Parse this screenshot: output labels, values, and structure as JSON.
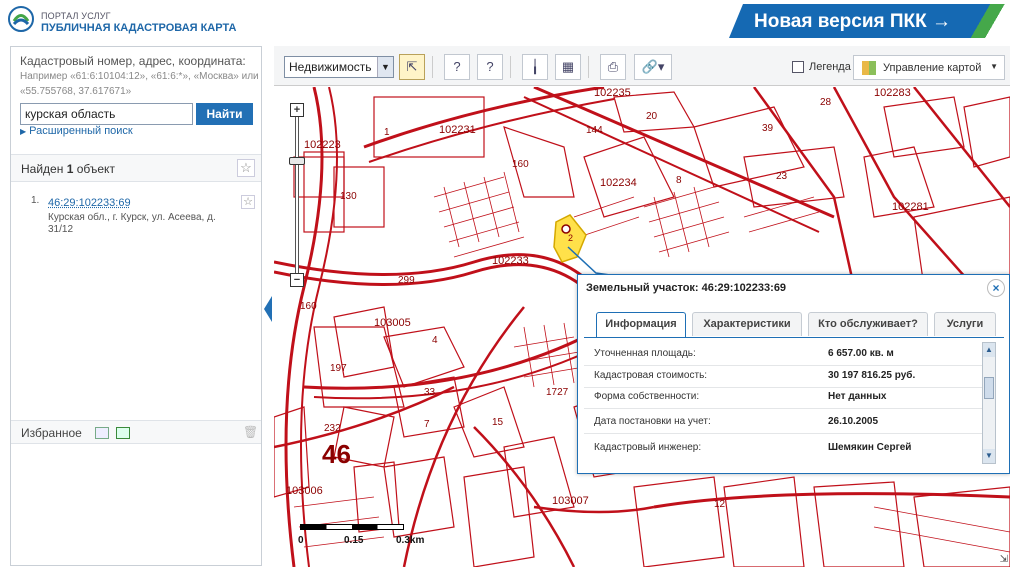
{
  "header": {
    "portal_line": "ПОРТАЛ УСЛУГ",
    "title": "ПУБЛИЧНАЯ КАДАСТРОВАЯ КАРТА",
    "new_version": "Новая версия ПКК →",
    "brand_color": "#1569b3"
  },
  "search": {
    "title": "Кадастровый номер, адрес, координата:",
    "example": "Например «61:6:10104:12», «61:6:*», «Москва» или «55.755768, 37.617671»",
    "value": "курская область",
    "button": "Найти",
    "advanced": "Расширенный поиск"
  },
  "results": {
    "found_prefix": "Найден",
    "found_count": "1",
    "found_suffix": "объект",
    "items": [
      {
        "num": "1.",
        "id": "46:29:102233:69",
        "address": "Курская обл., г. Курск, ул. Асеева, д. 31/12"
      }
    ]
  },
  "favorites": {
    "label": "Избранное"
  },
  "toolbar": {
    "layer": "Недвижимость",
    "legend": "Легенда",
    "map_control": "Управление картой"
  },
  "map": {
    "labels": [
      "102231",
      "102223",
      "102235",
      "160",
      "144",
      "20",
      "102234",
      "8",
      "23",
      "102281",
      "130",
      "1",
      "102233",
      "299",
      "103005",
      "160",
      "197",
      "4",
      "33",
      "7",
      "1727",
      "15",
      "103007",
      "12",
      "46",
      "103006",
      "232",
      "102283",
      "28",
      "39",
      "2"
    ],
    "scale": {
      "l0": "0",
      "l1": "0.15",
      "l2": "0.3km"
    }
  },
  "popup": {
    "title": "Земельный участок: 46:29:102233:69",
    "tabs": [
      "Информация",
      "Характеристики",
      "Кто обслуживает?",
      "Услуги"
    ],
    "rows": [
      {
        "label": "Уточненная площадь:",
        "value": "6 657.00 кв. м"
      },
      {
        "label": "Кадастровая стоимость:",
        "value": "30 197 816.25 руб."
      },
      {
        "label": "Форма собственности:",
        "value": "Нет данных"
      },
      {
        "label": "Дата постановки на учет:",
        "value": "26.10.2005"
      },
      {
        "label": "Кадастровый инженер:",
        "value": "Шемякин Сергей"
      }
    ]
  }
}
